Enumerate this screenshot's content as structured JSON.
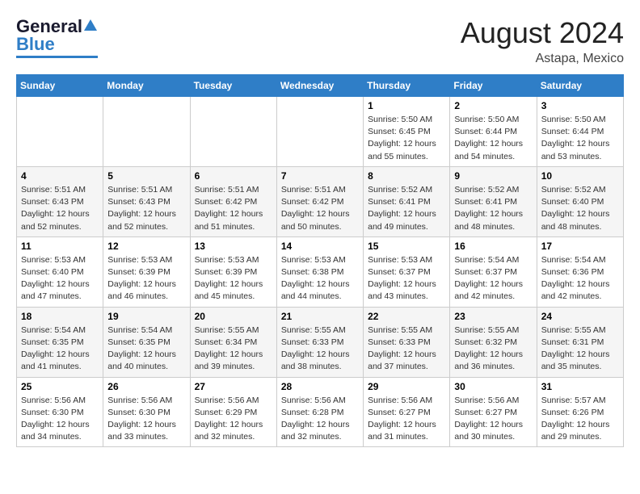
{
  "header": {
    "logo_general": "General",
    "logo_blue": "Blue",
    "month_year": "August 2024",
    "location": "Astapa, Mexico"
  },
  "days_of_week": [
    "Sunday",
    "Monday",
    "Tuesday",
    "Wednesday",
    "Thursday",
    "Friday",
    "Saturday"
  ],
  "weeks": [
    [
      {
        "day": "",
        "info": ""
      },
      {
        "day": "",
        "info": ""
      },
      {
        "day": "",
        "info": ""
      },
      {
        "day": "",
        "info": ""
      },
      {
        "day": "1",
        "info": "Sunrise: 5:50 AM\nSunset: 6:45 PM\nDaylight: 12 hours\nand 55 minutes."
      },
      {
        "day": "2",
        "info": "Sunrise: 5:50 AM\nSunset: 6:44 PM\nDaylight: 12 hours\nand 54 minutes."
      },
      {
        "day": "3",
        "info": "Sunrise: 5:50 AM\nSunset: 6:44 PM\nDaylight: 12 hours\nand 53 minutes."
      }
    ],
    [
      {
        "day": "4",
        "info": "Sunrise: 5:51 AM\nSunset: 6:43 PM\nDaylight: 12 hours\nand 52 minutes."
      },
      {
        "day": "5",
        "info": "Sunrise: 5:51 AM\nSunset: 6:43 PM\nDaylight: 12 hours\nand 52 minutes."
      },
      {
        "day": "6",
        "info": "Sunrise: 5:51 AM\nSunset: 6:42 PM\nDaylight: 12 hours\nand 51 minutes."
      },
      {
        "day": "7",
        "info": "Sunrise: 5:51 AM\nSunset: 6:42 PM\nDaylight: 12 hours\nand 50 minutes."
      },
      {
        "day": "8",
        "info": "Sunrise: 5:52 AM\nSunset: 6:41 PM\nDaylight: 12 hours\nand 49 minutes."
      },
      {
        "day": "9",
        "info": "Sunrise: 5:52 AM\nSunset: 6:41 PM\nDaylight: 12 hours\nand 48 minutes."
      },
      {
        "day": "10",
        "info": "Sunrise: 5:52 AM\nSunset: 6:40 PM\nDaylight: 12 hours\nand 48 minutes."
      }
    ],
    [
      {
        "day": "11",
        "info": "Sunrise: 5:53 AM\nSunset: 6:40 PM\nDaylight: 12 hours\nand 47 minutes."
      },
      {
        "day": "12",
        "info": "Sunrise: 5:53 AM\nSunset: 6:39 PM\nDaylight: 12 hours\nand 46 minutes."
      },
      {
        "day": "13",
        "info": "Sunrise: 5:53 AM\nSunset: 6:39 PM\nDaylight: 12 hours\nand 45 minutes."
      },
      {
        "day": "14",
        "info": "Sunrise: 5:53 AM\nSunset: 6:38 PM\nDaylight: 12 hours\nand 44 minutes."
      },
      {
        "day": "15",
        "info": "Sunrise: 5:53 AM\nSunset: 6:37 PM\nDaylight: 12 hours\nand 43 minutes."
      },
      {
        "day": "16",
        "info": "Sunrise: 5:54 AM\nSunset: 6:37 PM\nDaylight: 12 hours\nand 42 minutes."
      },
      {
        "day": "17",
        "info": "Sunrise: 5:54 AM\nSunset: 6:36 PM\nDaylight: 12 hours\nand 42 minutes."
      }
    ],
    [
      {
        "day": "18",
        "info": "Sunrise: 5:54 AM\nSunset: 6:35 PM\nDaylight: 12 hours\nand 41 minutes."
      },
      {
        "day": "19",
        "info": "Sunrise: 5:54 AM\nSunset: 6:35 PM\nDaylight: 12 hours\nand 40 minutes."
      },
      {
        "day": "20",
        "info": "Sunrise: 5:55 AM\nSunset: 6:34 PM\nDaylight: 12 hours\nand 39 minutes."
      },
      {
        "day": "21",
        "info": "Sunrise: 5:55 AM\nSunset: 6:33 PM\nDaylight: 12 hours\nand 38 minutes."
      },
      {
        "day": "22",
        "info": "Sunrise: 5:55 AM\nSunset: 6:33 PM\nDaylight: 12 hours\nand 37 minutes."
      },
      {
        "day": "23",
        "info": "Sunrise: 5:55 AM\nSunset: 6:32 PM\nDaylight: 12 hours\nand 36 minutes."
      },
      {
        "day": "24",
        "info": "Sunrise: 5:55 AM\nSunset: 6:31 PM\nDaylight: 12 hours\nand 35 minutes."
      }
    ],
    [
      {
        "day": "25",
        "info": "Sunrise: 5:56 AM\nSunset: 6:30 PM\nDaylight: 12 hours\nand 34 minutes."
      },
      {
        "day": "26",
        "info": "Sunrise: 5:56 AM\nSunset: 6:30 PM\nDaylight: 12 hours\nand 33 minutes."
      },
      {
        "day": "27",
        "info": "Sunrise: 5:56 AM\nSunset: 6:29 PM\nDaylight: 12 hours\nand 32 minutes."
      },
      {
        "day": "28",
        "info": "Sunrise: 5:56 AM\nSunset: 6:28 PM\nDaylight: 12 hours\nand 32 minutes."
      },
      {
        "day": "29",
        "info": "Sunrise: 5:56 AM\nSunset: 6:27 PM\nDaylight: 12 hours\nand 31 minutes."
      },
      {
        "day": "30",
        "info": "Sunrise: 5:56 AM\nSunset: 6:27 PM\nDaylight: 12 hours\nand 30 minutes."
      },
      {
        "day": "31",
        "info": "Sunrise: 5:57 AM\nSunset: 6:26 PM\nDaylight: 12 hours\nand 29 minutes."
      }
    ]
  ]
}
